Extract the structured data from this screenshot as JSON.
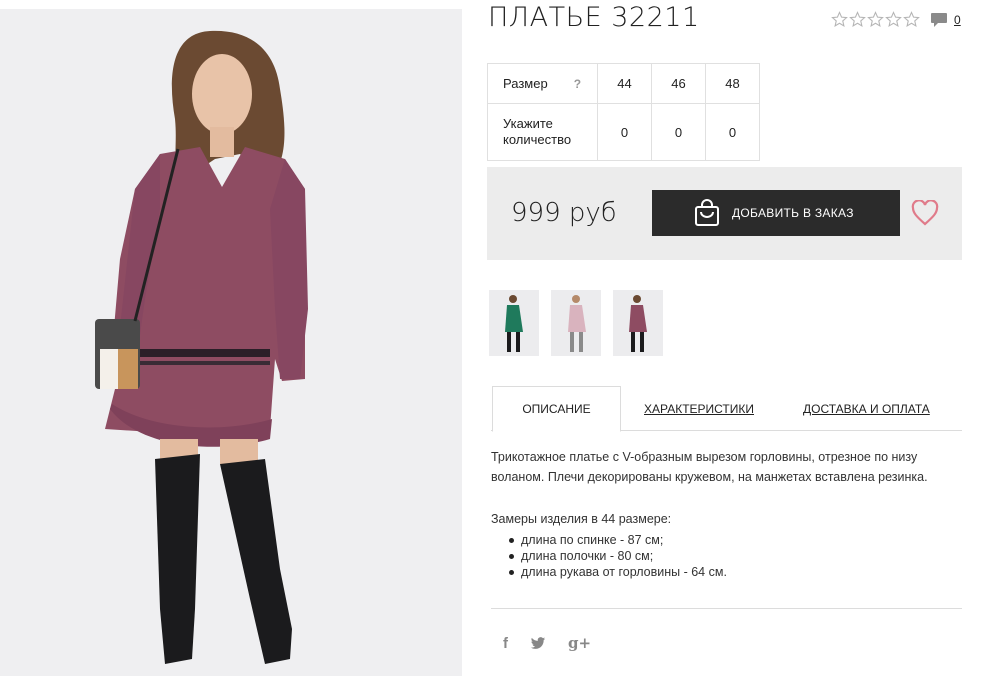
{
  "product": {
    "title": "ПЛАТЬЕ 32211",
    "rating_stars": 5,
    "rating_value": 0,
    "comments_count": "0"
  },
  "sizes": {
    "size_label": "Размер",
    "help_symbol": "?",
    "values": [
      "44",
      "46",
      "48"
    ],
    "qty_label": "Укажите количество",
    "quantities": [
      "0",
      "0",
      "0"
    ]
  },
  "buy": {
    "price": "999 руб",
    "add_label": "ДОБАВИТЬ В ЗАКАЗ"
  },
  "thumbnails": [
    {
      "name": "green",
      "color": "#1f7a5c"
    },
    {
      "name": "pink",
      "color": "#d9b3be"
    },
    {
      "name": "purple",
      "color": "#8e4c62"
    }
  ],
  "tabs": [
    {
      "label": "ОПИСАНИЕ",
      "active": true
    },
    {
      "label": "ХАРАКТЕРИСТИКИ",
      "active": false
    },
    {
      "label": "ДОСТАВКА И ОПЛАТА",
      "active": false
    }
  ],
  "description": {
    "text": "Трикотажное платье с V-образным вырезом горловины, отрезное по низу воланом. Плечи декорированы кружевом, на манжетах вставлена резинка.",
    "measure_title": "Замеры изделия в 44 размере:",
    "measures": [
      "длина по спинке - 87 см;",
      "длина полочки - 80 см;",
      "длина рукава от горловины - 64 см."
    ]
  },
  "social": {
    "facebook": "f",
    "twitter_icon": "twitter-icon",
    "googleplus": "g+"
  },
  "colors": {
    "button_bg": "#2b2b2b",
    "buybox_bg": "#ececec",
    "heart": "#e07b8a",
    "dress": "#8e4c62"
  }
}
